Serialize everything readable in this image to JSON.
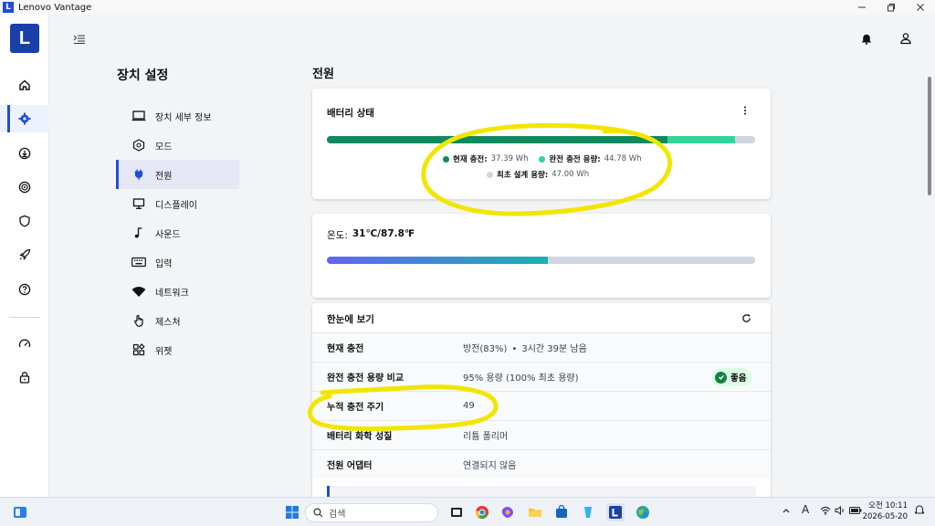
{
  "window": {
    "title": "Lenovo Vantage",
    "logo_letter": "L"
  },
  "rail": {
    "items": [
      "home-icon",
      "settings-icon",
      "download-icon",
      "smart-icon",
      "shield-icon",
      "rocket-icon",
      "help-icon",
      "gauge-icon",
      "lock-icon"
    ]
  },
  "settings": {
    "title": "장치 설정",
    "nav": [
      {
        "label": "장치 세부 정보",
        "icon": "laptop-icon"
      },
      {
        "label": "모드",
        "icon": "hexagon-icon"
      },
      {
        "label": "전원",
        "icon": "plug-icon"
      },
      {
        "label": "디스플레이",
        "icon": "monitor-icon"
      },
      {
        "label": "사운드",
        "icon": "music-icon"
      },
      {
        "label": "입력",
        "icon": "keyboard-icon"
      },
      {
        "label": "네트워크",
        "icon": "wifi-icon"
      },
      {
        "label": "제스처",
        "icon": "hand-icon"
      },
      {
        "label": "위젯",
        "icon": "widgets-icon"
      }
    ]
  },
  "page": {
    "title": "전원"
  },
  "battery": {
    "title": "배터리 상태",
    "current_label": "현재 충전:",
    "current_value": "37.39 Wh",
    "full_label": "완전 충전 용량:",
    "full_value": "44.78 Wh",
    "design_label": "최초 설계 용량:",
    "design_value": "47.00 Wh",
    "current_fraction": 0.795,
    "full_fraction": 0.953,
    "colors": {
      "current": "#0e8a5f",
      "full": "#34d399",
      "design": "#cfd6e0"
    }
  },
  "temperature": {
    "label": "온도:",
    "value": "31℃/87.8℉",
    "fraction": 0.516
  },
  "glance": {
    "title": "한눈에 보기",
    "rows": [
      {
        "label": "현재 충전",
        "value": "방전(83%)",
        "extra": "3시간 39분 남음"
      },
      {
        "label": "완전 충전 용량 비교",
        "value": "95% 용량 (100% 최초 용량)",
        "badge": "좋음"
      },
      {
        "label": "누적 충전 주기",
        "value": "49"
      },
      {
        "label": "배터리 화학 성질",
        "value": "리튬 폴리머"
      },
      {
        "label": "전원 어댑터",
        "value": "연결되지 않음"
      }
    ]
  },
  "taskbar": {
    "search_placeholder": "검색",
    "time": "오전 10:11",
    "date": "2026-05-20",
    "ime": "A"
  }
}
